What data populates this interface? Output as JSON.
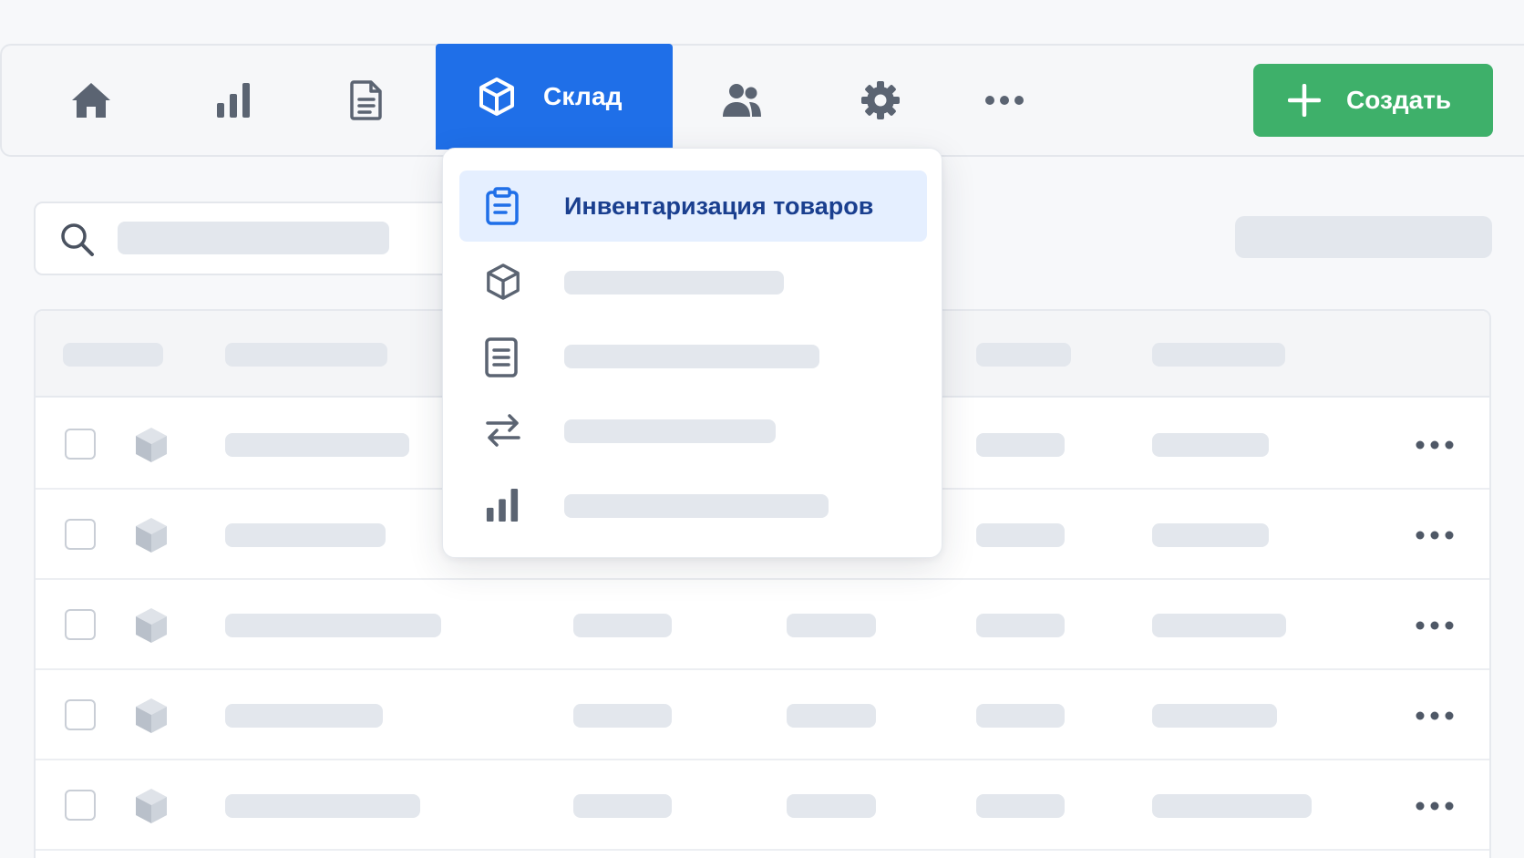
{
  "nav": {
    "items": [
      {
        "icon": "home-icon"
      },
      {
        "icon": "bar-chart-icon"
      },
      {
        "icon": "document-icon"
      },
      {
        "icon": "box-icon",
        "label": "Склад",
        "active": true
      },
      {
        "icon": "users-icon"
      },
      {
        "icon": "gear-icon"
      },
      {
        "icon": "more-horizontal-icon"
      }
    ],
    "active_label": "Склад",
    "create_button": {
      "icon": "plus-icon",
      "label": "Создать"
    }
  },
  "dropdown": {
    "items": [
      {
        "icon": "clipboard-icon",
        "label": "Инвентаризация товаров",
        "active": true
      },
      {
        "icon": "box-icon",
        "label": ""
      },
      {
        "icon": "list-document-icon",
        "label": ""
      },
      {
        "icon": "transfer-arrows-icon",
        "label": ""
      },
      {
        "icon": "bar-chart-icon",
        "label": ""
      }
    ]
  },
  "search": {
    "icon": "search-icon"
  },
  "table": {
    "row_count": 5,
    "row_icon": "cube-icon",
    "row_action_icon": "more-horizontal-icon"
  },
  "colors": {
    "accent": "#1f6fe8",
    "create_green": "#3eb06a",
    "dropdown_active_bg": "#e5efff",
    "dropdown_active_text": "#1a3f8f",
    "skeleton": "#e3e7ed"
  }
}
